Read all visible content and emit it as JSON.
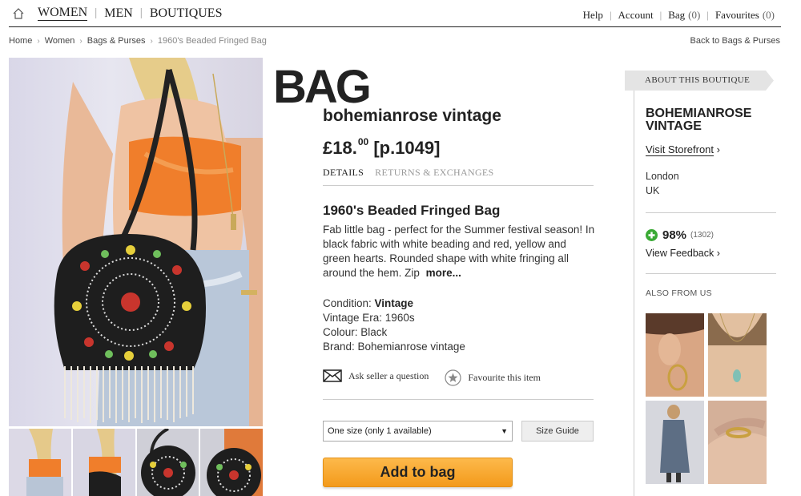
{
  "nav": {
    "home_icon": "home-icon",
    "main": [
      "WOMEN",
      "MEN",
      "BOUTIQUES"
    ],
    "help": "Help",
    "account": "Account",
    "bag": "Bag",
    "bag_count": "(0)",
    "favourites": "Favourites",
    "favourites_count": "(0)"
  },
  "breadcrumb": {
    "items": [
      "Home",
      "Women",
      "Bags & Purses"
    ],
    "current": "1960's Beaded Fringed Bag",
    "back": "Back to Bags & Purses"
  },
  "product": {
    "logo": "BAG",
    "seller": "bohemianrose vintage",
    "price_main": "£18.",
    "price_pence": "00",
    "price_code": "[p.1049]",
    "tabs": [
      "DETAILS",
      "RETURNS & EXCHANGES"
    ],
    "title": "1960's Beaded Fringed Bag",
    "description": "Fab little bag - perfect for the Summer festival season! In black fabric with white beading and red, yellow and green hearts. Rounded shape with white fringing all around the hem. Zip",
    "more": "more...",
    "condition_label": "Condition: ",
    "condition_value": "Vintage",
    "era": "Vintage Era: 1960s",
    "colour": "Colour: Black",
    "brand": "Brand: Bohemianrose vintage",
    "ask_seller": "Ask seller a question",
    "favourite": "Favourite this item",
    "size_option": "One size (only 1 available)",
    "size_guide": "Size Guide",
    "add_to_bag": "Add to bag"
  },
  "sidebar": {
    "ribbon": "ABOUT THIS BOUTIQUE",
    "name": "BOHEMIANROSE VINTAGE",
    "storefront": "Visit Storefront",
    "city": "London",
    "country": "UK",
    "rating_pct": "98%",
    "rating_count": "(1302)",
    "feedback": "View Feedback",
    "also": "ALSO FROM US"
  },
  "colors": {
    "accent_orange": "#f5a22a",
    "rating_green": "#3aaa35",
    "text": "#222222"
  }
}
